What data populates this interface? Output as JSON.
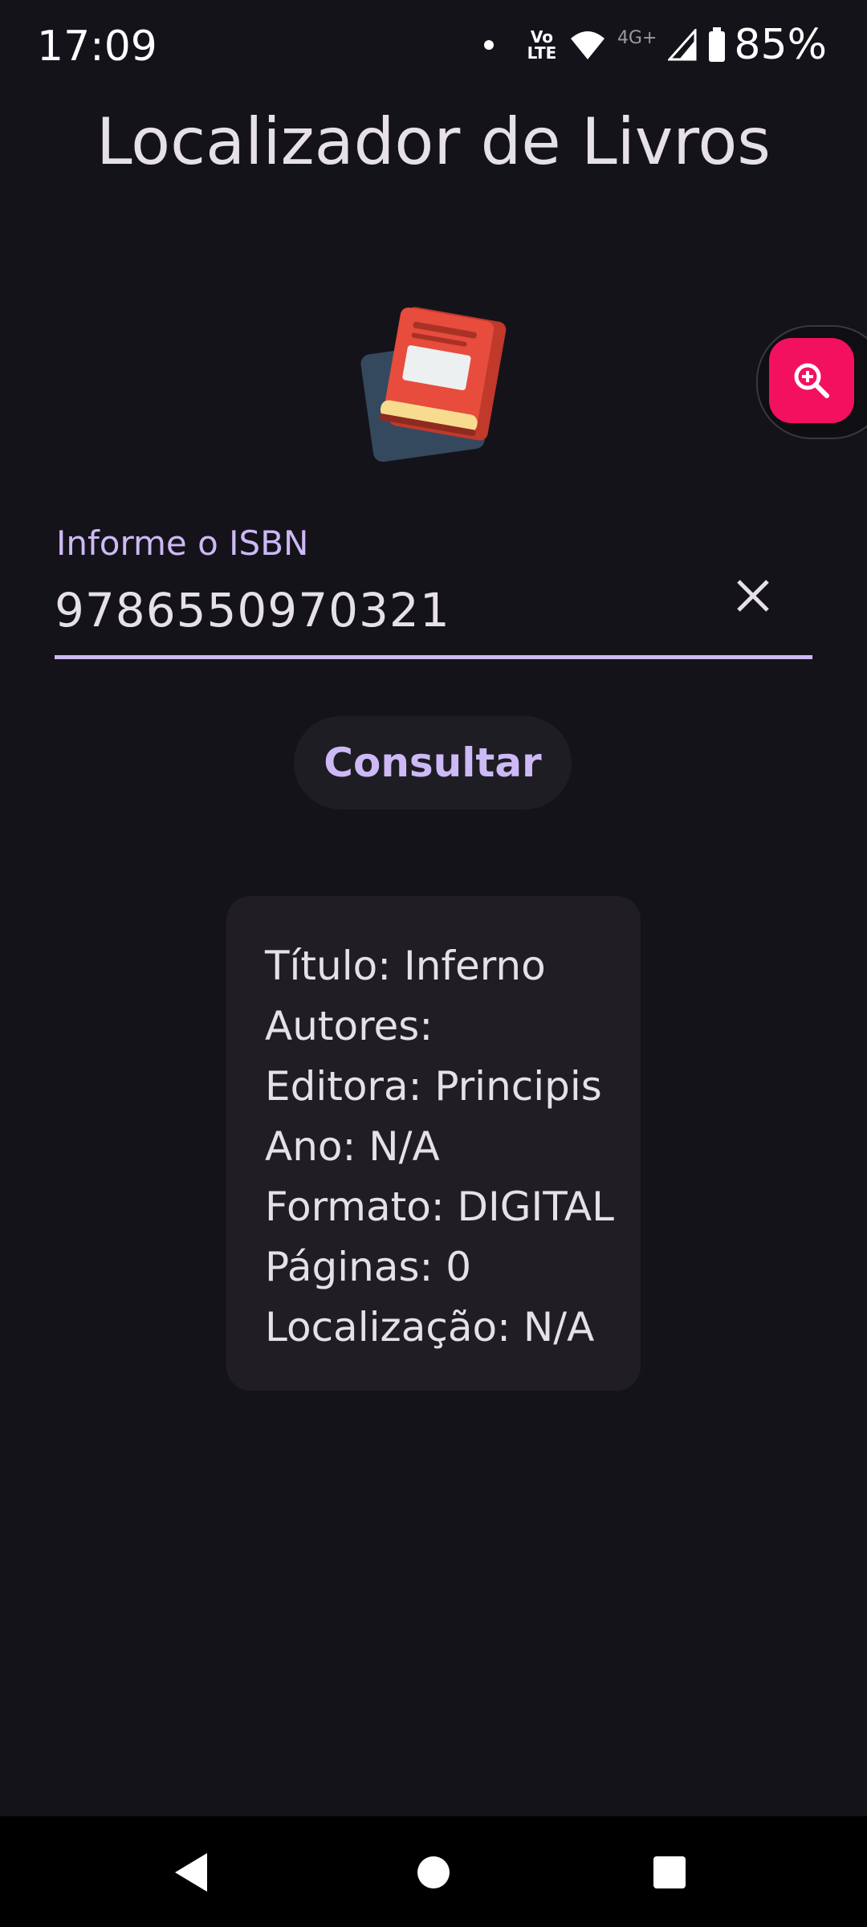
{
  "status_bar": {
    "time": "17:09",
    "volte_label": "Vo LTE",
    "network_label": "4G+",
    "battery": "85%",
    "icons": [
      "notification-dot-icon",
      "volte-icon",
      "wifi-icon",
      "signal-icon",
      "battery-icon"
    ]
  },
  "app": {
    "title": "Localizador de Livros",
    "logo_icon": "book-stack-icon",
    "zoom_icon": "zoom-in-icon"
  },
  "isbn_field": {
    "label": "Informe o ISBN",
    "value": "9786550970321",
    "clear_icon": "close-icon"
  },
  "actions": {
    "consult_label": "Consultar"
  },
  "result": {
    "lines": [
      "Título: Inferno",
      "Autores:",
      "Editora: Principis",
      "Ano: N/A",
      "Formato: DIGITAL",
      "Páginas: 0",
      "Localização: N/A"
    ]
  },
  "nav_bar": {
    "icons": [
      "back-icon",
      "home-icon",
      "recents-icon"
    ]
  },
  "colors": {
    "background": "#15131a",
    "accent": "#cdb9f5",
    "fab": "#f3115f",
    "card": "#201e24"
  }
}
